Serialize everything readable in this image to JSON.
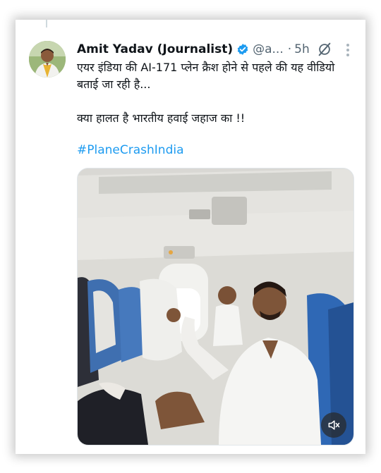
{
  "post": {
    "author_name": "Amit Yadav (Journalist)",
    "handle": "@a...",
    "separator": "·",
    "time": "5h",
    "text_line1": "एयर इंडिया की AI-171 प्लेन क्रैश होने से पहले की यह वीडियो बताई जा रही है...",
    "text_line2": "क्या हालत है भारतीय हवाई जहाज का !!",
    "hashtag": "#PlaneCrashIndia"
  },
  "icons": {
    "verified": "verified-badge-icon",
    "grok": "grok-icon",
    "more": "more-options-icon",
    "mute": "muted-speaker-icon"
  },
  "colors": {
    "link": "#1d9bf0",
    "verified": "#1d9bf0",
    "text": "#0f1419",
    "muted_text": "#536471"
  }
}
